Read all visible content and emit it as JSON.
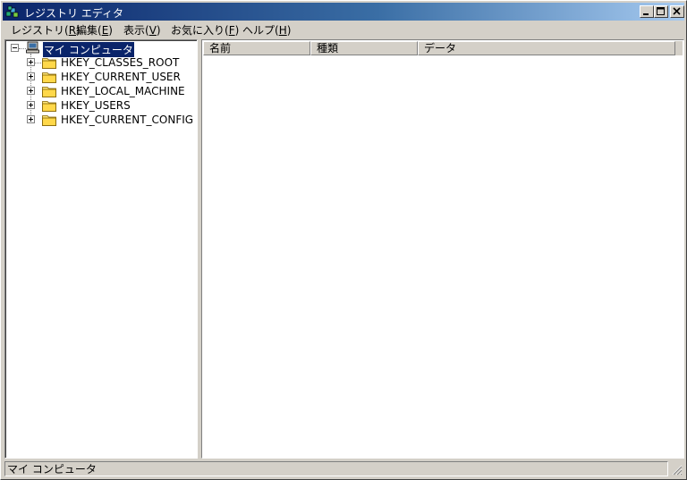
{
  "window": {
    "title": "レジストリ エディタ"
  },
  "title_controls": {
    "minimize": "_",
    "maximize": "□",
    "close": "×"
  },
  "menubar": {
    "items": [
      {
        "label": "レジストリ(",
        "key": "R",
        "suffix": ")"
      },
      {
        "label": "編集(",
        "key": "E",
        "suffix": ")"
      },
      {
        "label": "表示(",
        "key": "V",
        "suffix": ")"
      },
      {
        "label": "お気に入り(",
        "key": "F",
        "suffix": ")"
      },
      {
        "label": "ヘルプ(",
        "key": "H",
        "suffix": ")"
      }
    ]
  },
  "tree": {
    "root": {
      "label": "マイ コンピュータ",
      "icon": "computer-icon",
      "expanded": true,
      "selected": true
    },
    "items": [
      {
        "label": "HKEY_CLASSES_ROOT",
        "icon": "folder-icon"
      },
      {
        "label": "HKEY_CURRENT_USER",
        "icon": "folder-icon"
      },
      {
        "label": "HKEY_LOCAL_MACHINE",
        "icon": "folder-icon"
      },
      {
        "label": "HKEY_USERS",
        "icon": "folder-icon"
      },
      {
        "label": "HKEY_CURRENT_CONFIG",
        "icon": "folder-icon"
      }
    ]
  },
  "list": {
    "columns": [
      "名前",
      "種類",
      "データ"
    ],
    "rows": []
  },
  "statusbar": {
    "text": "マイ コンピュータ"
  },
  "colors": {
    "title_start": "#0a246a",
    "title_end": "#a6caf0",
    "selection": "#0a246a",
    "face": "#d4d0c8"
  }
}
